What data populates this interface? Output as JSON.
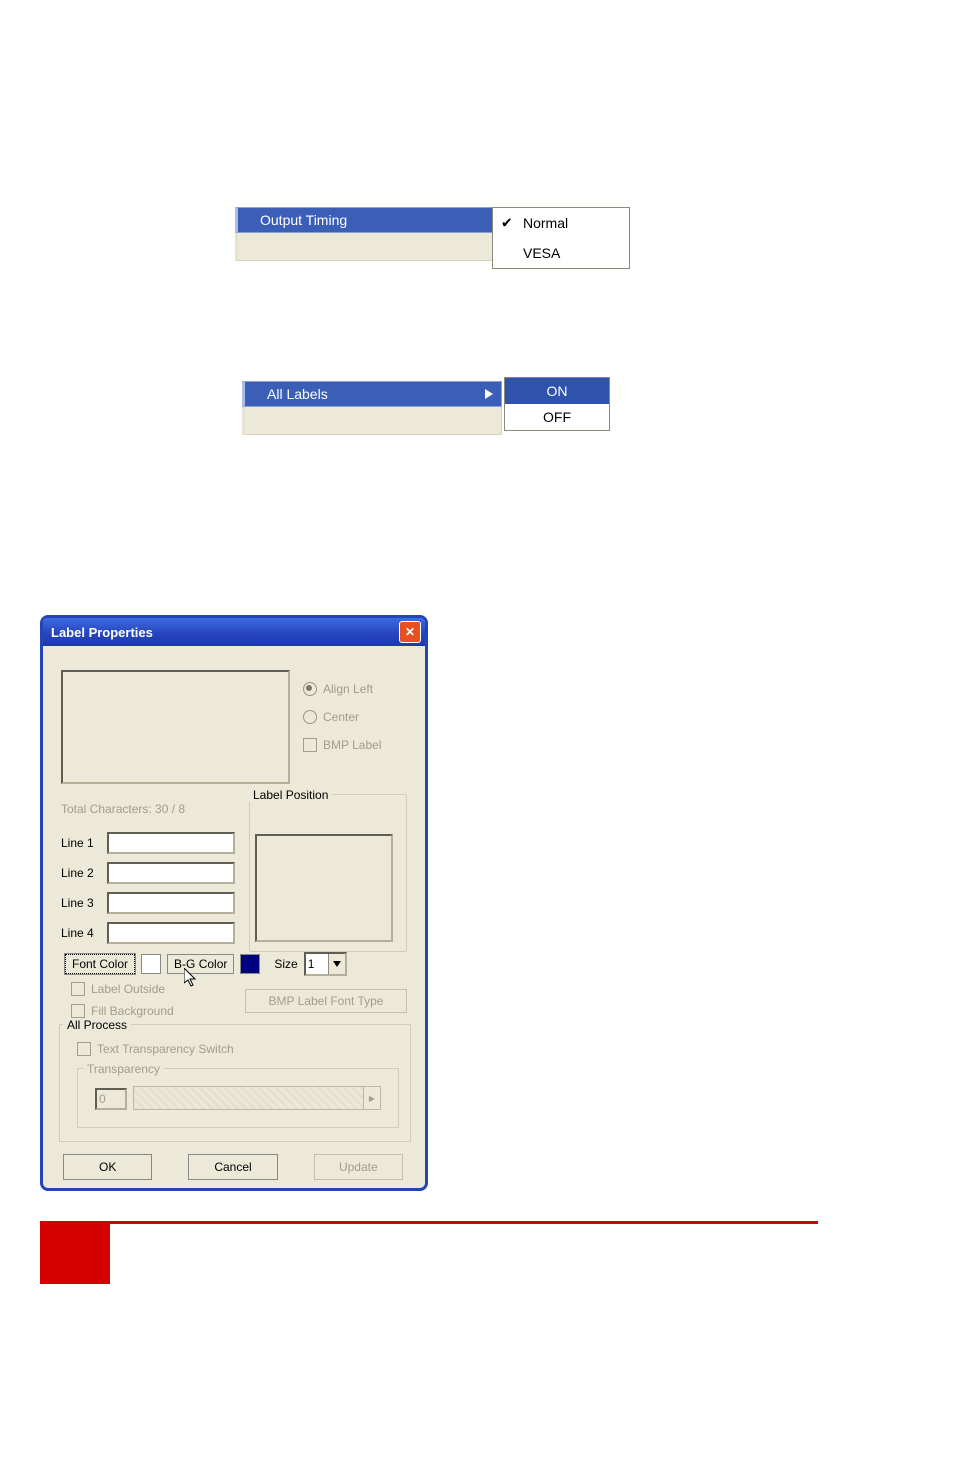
{
  "menu_output_timing": {
    "label": "Output Timing",
    "options": [
      {
        "label": "Normal",
        "checked": true
      },
      {
        "label": "VESA",
        "checked": false
      }
    ]
  },
  "menu_all_labels": {
    "label": "All Labels",
    "options": [
      {
        "label": "ON",
        "highlighted": true
      },
      {
        "label": "OFF",
        "highlighted": false
      }
    ]
  },
  "dialog": {
    "title": "Label Properties",
    "align": {
      "align_left": "Align Left",
      "center": "Center",
      "bmp_label": "BMP Label"
    },
    "total_characters_label": "Total Characters: 30 /    8",
    "lines": {
      "line1": "Line 1",
      "line2": "Line 2",
      "line3": "Line 3",
      "line4": "Line 4",
      "values": {
        "line1": "",
        "line2": "",
        "line3": "",
        "line4": ""
      }
    },
    "label_position": "Label Position",
    "font_color_btn": "Font Color",
    "bg_color_btn": "B-G Color",
    "size_label": "Size",
    "size_value": "1",
    "font_color_hex": "#FFFFFF",
    "bg_color_hex": "#000080",
    "label_outside": "Label Outside",
    "fill_background": "Fill Background",
    "bmp_font_btn": "BMP Label Font Type",
    "all_process": "All Process",
    "text_transparency_switch": "Text Transparency Switch",
    "transparency_label": "Transparency",
    "transparency_value": "0",
    "buttons": {
      "ok": "OK",
      "cancel": "Cancel",
      "update": "Update"
    }
  }
}
